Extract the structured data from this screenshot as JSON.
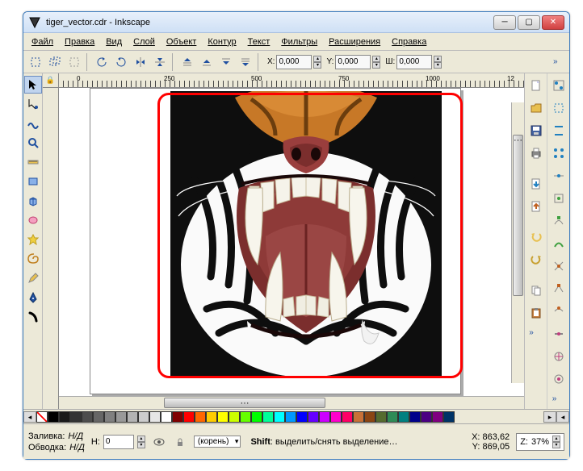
{
  "window": {
    "title": "tiger_vector.cdr - Inkscape"
  },
  "menu": {
    "file": "Файл",
    "edit": "Правка",
    "view": "Вид",
    "layer": "Слой",
    "object": "Объект",
    "path": "Контур",
    "text": "Текст",
    "filters": "Фильтры",
    "extensions": "Расширения",
    "help": "Справка"
  },
  "toolbar": {
    "x_label": "X:",
    "x_value": "0,000",
    "y_label": "Y:",
    "y_value": "0,000",
    "w_label": "Ш:",
    "w_value": "0,000"
  },
  "ruler": {
    "marks": [
      "0",
      "250",
      "500",
      "750",
      "1000",
      "12"
    ]
  },
  "status": {
    "fill_label": "Заливка:",
    "fill_value": "Н/Д",
    "stroke_label": "Обводка:",
    "stroke_value": "Н/Д",
    "h_label": "Н:",
    "h_value": "0",
    "layer_value": "(корень)",
    "hint_prefix": "Shift",
    "hint_text": ": выделить/снять выделение…",
    "coord_x_label": "X:",
    "coord_x": "863,62",
    "coord_y_label": "Y:",
    "coord_y": "869,05",
    "zoom_label": "Z:",
    "zoom_value": "37%"
  },
  "palette": [
    "#000000",
    "#1a1a1a",
    "#333333",
    "#4d4d4d",
    "#666666",
    "#808080",
    "#999999",
    "#b3b3b3",
    "#cccccc",
    "#e6e6e6",
    "#ffffff",
    "#800000",
    "#ff0000",
    "#ff6600",
    "#ffcc00",
    "#ffff00",
    "#ccff00",
    "#66ff00",
    "#00ff00",
    "#00ff99",
    "#00ffff",
    "#0099ff",
    "#0000ff",
    "#6600ff",
    "#cc00ff",
    "#ff00cc",
    "#ff0066",
    "#c87137",
    "#8b4513",
    "#556b2f",
    "#2e8b57",
    "#008080",
    "#00008b",
    "#4b0082",
    "#800080",
    "#003366"
  ]
}
